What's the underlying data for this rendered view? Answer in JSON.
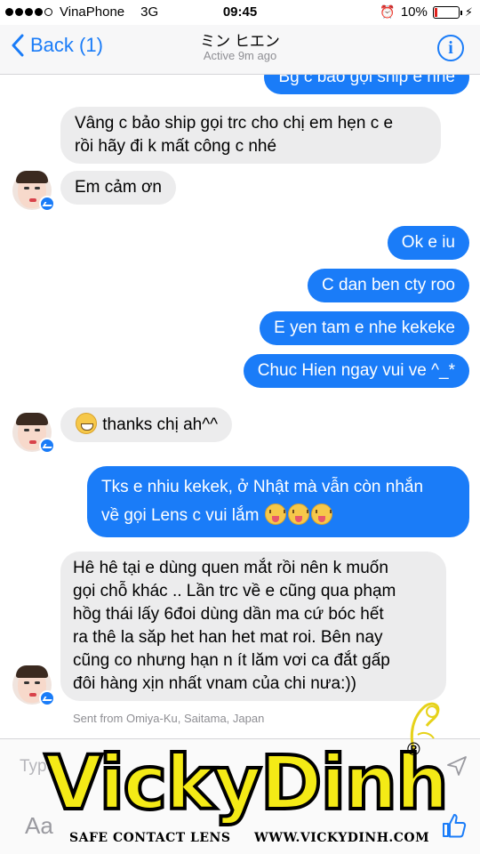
{
  "status_bar": {
    "carrier": "VinaPhone",
    "network": "3G",
    "time": "09:45",
    "battery": "10%",
    "signal_bars": 4
  },
  "nav": {
    "back_label": "Back (1)",
    "title": "ミン ヒエン",
    "subtitle": "Active 9m ago",
    "info_label": "i"
  },
  "messages": [
    {
      "id": "m0",
      "direction": "out",
      "text": "Bg c bảo gọi ship e nhe"
    },
    {
      "id": "m1",
      "direction": "in",
      "lines": [
        "Vâng c bảo ship gọi trc cho chị em hẹn c e",
        "rồi hãy đi k mất công c nhé"
      ]
    },
    {
      "id": "m2",
      "direction": "in",
      "text": "Em cảm ơn"
    },
    {
      "id": "m3",
      "direction": "out",
      "text": "Ok e iu"
    },
    {
      "id": "m4",
      "direction": "out",
      "text": "C dan ben cty roo"
    },
    {
      "id": "m5",
      "direction": "out",
      "text": "E yen tam e nhe kekeke"
    },
    {
      "id": "m6",
      "direction": "out",
      "text": "Chuc Hien ngay vui ve ^_*"
    },
    {
      "id": "m7",
      "direction": "in",
      "text": "thanks chị ah^^",
      "emoji": "grinning-face"
    },
    {
      "id": "m8",
      "direction": "out",
      "lines": [
        "Tks e nhiu kekek, ở Nhật mà vẫn còn nhắn",
        "về gọi Lens c vui lắm"
      ],
      "emoji": "squinting-tongue-face"
    },
    {
      "id": "m9",
      "direction": "in",
      "lines": [
        "Hê hê tại e dùng quen mắt rồi nên k muốn",
        "gọi chỗ khác .. Lần trc về e cũng qua phạm",
        "hồg thái lấy 6đoi dùng dần ma cứ bóc hết",
        "ra thê la săp het han het mat roi. Bên nay",
        "cũng co nhưng hạn n ít lăm vơi ca đắt gấp",
        "đôi hàng xịn nhất vnam của chi nưa:))"
      ]
    }
  ],
  "location_note": "Sent from Omiya-Ku, Saitama, Japan",
  "input": {
    "placeholder": "Type",
    "aa_label": "Aa"
  },
  "watermark": {
    "brand": "VickyDinh",
    "registered": "®",
    "tagline_left": "SAFE CONTACT LENS",
    "tagline_right": "WWW.VICKYDINH.COM"
  },
  "colors": {
    "outgoing_bubble": "#1a7cf8",
    "incoming_bubble": "#ececed",
    "accent": "#1a7cf8",
    "watermark_yellow": "#f4ea16"
  }
}
